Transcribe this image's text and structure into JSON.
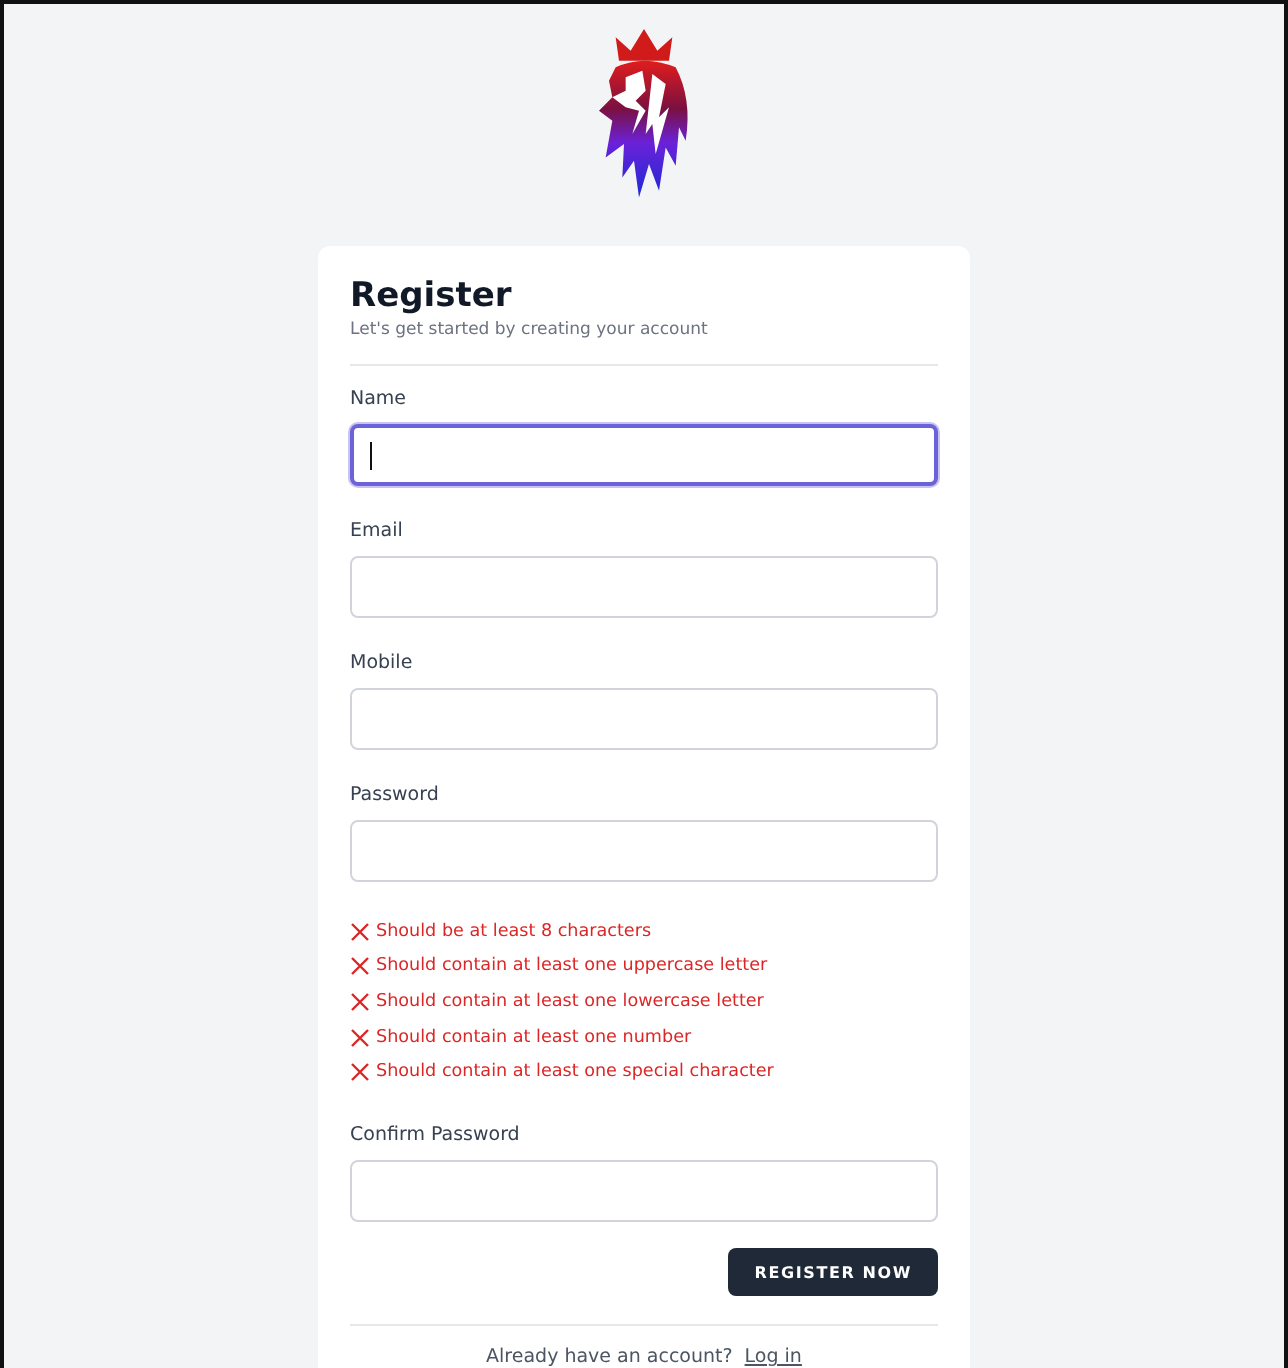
{
  "title": "Register",
  "subtitle": "Let's get started by creating your account",
  "fields": [
    {
      "label": "Name",
      "focused": true,
      "kind": "text"
    },
    {
      "label": "Email",
      "focused": false,
      "kind": "text"
    },
    {
      "label": "Mobile",
      "focused": false,
      "kind": "text"
    },
    {
      "label": "Password",
      "focused": false,
      "kind": "password"
    },
    {
      "label": "Confirm Password",
      "focused": false,
      "kind": "text"
    }
  ],
  "password_rules": [
    {
      "text": "Should be at least 8 characters",
      "met": false
    },
    {
      "text": "Should contain at least one uppercase letter",
      "met": false
    },
    {
      "text": "Should contain at least one lowercase letter",
      "met": false
    },
    {
      "text": "Should contain at least one number",
      "met": false
    },
    {
      "text": "Should contain at least one special character",
      "met": false
    }
  ],
  "submit_button": "REGISTER NOW",
  "footer": {
    "text": "Already have an account?",
    "link": "Log in"
  }
}
